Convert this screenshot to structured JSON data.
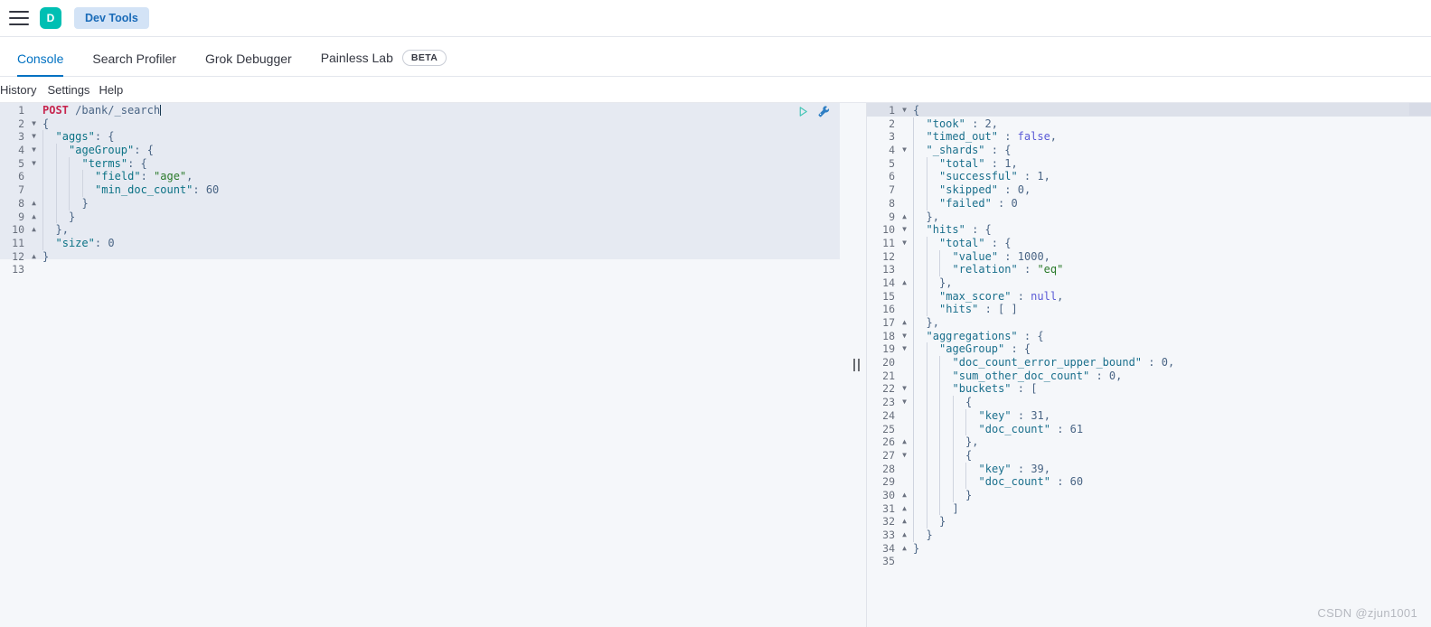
{
  "header": {
    "menu_icon": "hamburger-menu-icon",
    "logo_letter": "D",
    "app_badge": "Dev Tools"
  },
  "tabs": [
    {
      "label": "Console",
      "active": true,
      "badge": null
    },
    {
      "label": "Search Profiler",
      "active": false,
      "badge": null
    },
    {
      "label": "Grok Debugger",
      "active": false,
      "badge": null
    },
    {
      "label": "Painless Lab",
      "active": false,
      "badge": "BETA"
    }
  ],
  "submenu": [
    {
      "label": "History"
    },
    {
      "label": "Settings"
    },
    {
      "label": "Help"
    }
  ],
  "editor_actions": [
    {
      "name": "play-icon",
      "title": "Click to send request"
    },
    {
      "name": "wrench-icon",
      "title": "Open documentation"
    }
  ],
  "request": {
    "method": "POST",
    "url": "/bank/_search",
    "lines": [
      {
        "n": 1,
        "fold": "",
        "indent": 0,
        "parts": [
          {
            "c": "t-method",
            "t": "POST"
          },
          {
            "c": "t-punc",
            "t": " "
          },
          {
            "c": "t-url",
            "t": "/bank/_search"
          },
          {
            "c": "caret",
            "t": ""
          }
        ]
      },
      {
        "n": 2,
        "fold": "v",
        "indent": 0,
        "parts": [
          {
            "c": "t-punc",
            "t": "{"
          }
        ]
      },
      {
        "n": 3,
        "fold": "v",
        "indent": 1,
        "parts": [
          {
            "c": "t-key",
            "t": "\"aggs\""
          },
          {
            "c": "t-punc",
            "t": ": {"
          }
        ]
      },
      {
        "n": 4,
        "fold": "v",
        "indent": 2,
        "parts": [
          {
            "c": "t-key",
            "t": "\"ageGroup\""
          },
          {
            "c": "t-punc",
            "t": ": {"
          }
        ]
      },
      {
        "n": 5,
        "fold": "v",
        "indent": 3,
        "parts": [
          {
            "c": "t-key",
            "t": "\"terms\""
          },
          {
            "c": "t-punc",
            "t": ": {"
          }
        ]
      },
      {
        "n": 6,
        "fold": "",
        "indent": 4,
        "parts": [
          {
            "c": "t-key",
            "t": "\"field\""
          },
          {
            "c": "t-punc",
            "t": ": "
          },
          {
            "c": "t-str",
            "t": "\"age\""
          },
          {
            "c": "t-punc",
            "t": ","
          }
        ]
      },
      {
        "n": 7,
        "fold": "",
        "indent": 4,
        "parts": [
          {
            "c": "t-key",
            "t": "\"min_doc_count\""
          },
          {
            "c": "t-punc",
            "t": ": "
          },
          {
            "c": "t-num",
            "t": "60"
          }
        ]
      },
      {
        "n": 8,
        "fold": "^",
        "indent": 3,
        "parts": [
          {
            "c": "t-punc",
            "t": "}"
          }
        ]
      },
      {
        "n": 9,
        "fold": "^",
        "indent": 2,
        "parts": [
          {
            "c": "t-punc",
            "t": "}"
          }
        ]
      },
      {
        "n": 10,
        "fold": "^",
        "indent": 1,
        "parts": [
          {
            "c": "t-punc",
            "t": "},"
          }
        ]
      },
      {
        "n": 11,
        "fold": "",
        "indent": 1,
        "parts": [
          {
            "c": "t-key",
            "t": "\"size\""
          },
          {
            "c": "t-punc",
            "t": ": "
          },
          {
            "c": "t-num",
            "t": "0"
          }
        ]
      },
      {
        "n": 12,
        "fold": "^",
        "indent": 0,
        "parts": [
          {
            "c": "t-punc",
            "t": "}"
          }
        ]
      },
      {
        "n": 13,
        "fold": "",
        "indent": 0,
        "parts": []
      }
    ]
  },
  "response": {
    "lines": [
      {
        "n": 1,
        "fold": "v",
        "indent": 0,
        "parts": [
          {
            "c": "t-punc",
            "t": "{"
          }
        ]
      },
      {
        "n": 2,
        "fold": "",
        "indent": 1,
        "parts": [
          {
            "c": "t-keyres",
            "t": "\"took\""
          },
          {
            "c": "t-punc",
            "t": " : "
          },
          {
            "c": "t-num",
            "t": "2"
          },
          {
            "c": "t-punc",
            "t": ","
          }
        ]
      },
      {
        "n": 3,
        "fold": "",
        "indent": 1,
        "parts": [
          {
            "c": "t-keyres",
            "t": "\"timed_out\""
          },
          {
            "c": "t-punc",
            "t": " : "
          },
          {
            "c": "t-bool",
            "t": "false"
          },
          {
            "c": "t-punc",
            "t": ","
          }
        ]
      },
      {
        "n": 4,
        "fold": "v",
        "indent": 1,
        "parts": [
          {
            "c": "t-keyres",
            "t": "\"_shards\""
          },
          {
            "c": "t-punc",
            "t": " : {"
          }
        ]
      },
      {
        "n": 5,
        "fold": "",
        "indent": 2,
        "parts": [
          {
            "c": "t-keyres",
            "t": "\"total\""
          },
          {
            "c": "t-punc",
            "t": " : "
          },
          {
            "c": "t-num",
            "t": "1"
          },
          {
            "c": "t-punc",
            "t": ","
          }
        ]
      },
      {
        "n": 6,
        "fold": "",
        "indent": 2,
        "parts": [
          {
            "c": "t-keyres",
            "t": "\"successful\""
          },
          {
            "c": "t-punc",
            "t": " : "
          },
          {
            "c": "t-num",
            "t": "1"
          },
          {
            "c": "t-punc",
            "t": ","
          }
        ]
      },
      {
        "n": 7,
        "fold": "",
        "indent": 2,
        "parts": [
          {
            "c": "t-keyres",
            "t": "\"skipped\""
          },
          {
            "c": "t-punc",
            "t": " : "
          },
          {
            "c": "t-num",
            "t": "0"
          },
          {
            "c": "t-punc",
            "t": ","
          }
        ]
      },
      {
        "n": 8,
        "fold": "",
        "indent": 2,
        "parts": [
          {
            "c": "t-keyres",
            "t": "\"failed\""
          },
          {
            "c": "t-punc",
            "t": " : "
          },
          {
            "c": "t-num",
            "t": "0"
          }
        ]
      },
      {
        "n": 9,
        "fold": "^",
        "indent": 1,
        "parts": [
          {
            "c": "t-punc",
            "t": "},"
          }
        ]
      },
      {
        "n": 10,
        "fold": "v",
        "indent": 1,
        "parts": [
          {
            "c": "t-keyres",
            "t": "\"hits\""
          },
          {
            "c": "t-punc",
            "t": " : {"
          }
        ]
      },
      {
        "n": 11,
        "fold": "v",
        "indent": 2,
        "parts": [
          {
            "c": "t-keyres",
            "t": "\"total\""
          },
          {
            "c": "t-punc",
            "t": " : {"
          }
        ]
      },
      {
        "n": 12,
        "fold": "",
        "indent": 3,
        "parts": [
          {
            "c": "t-keyres",
            "t": "\"value\""
          },
          {
            "c": "t-punc",
            "t": " : "
          },
          {
            "c": "t-num",
            "t": "1000"
          },
          {
            "c": "t-punc",
            "t": ","
          }
        ]
      },
      {
        "n": 13,
        "fold": "",
        "indent": 3,
        "parts": [
          {
            "c": "t-keyres",
            "t": "\"relation\""
          },
          {
            "c": "t-punc",
            "t": " : "
          },
          {
            "c": "t-strres",
            "t": "\"eq\""
          }
        ]
      },
      {
        "n": 14,
        "fold": "^",
        "indent": 2,
        "parts": [
          {
            "c": "t-punc",
            "t": "},"
          }
        ]
      },
      {
        "n": 15,
        "fold": "",
        "indent": 2,
        "parts": [
          {
            "c": "t-keyres",
            "t": "\"max_score\""
          },
          {
            "c": "t-punc",
            "t": " : "
          },
          {
            "c": "t-null",
            "t": "null"
          },
          {
            "c": "t-punc",
            "t": ","
          }
        ]
      },
      {
        "n": 16,
        "fold": "",
        "indent": 2,
        "parts": [
          {
            "c": "t-keyres",
            "t": "\"hits\""
          },
          {
            "c": "t-punc",
            "t": " : [ ]"
          }
        ]
      },
      {
        "n": 17,
        "fold": "^",
        "indent": 1,
        "parts": [
          {
            "c": "t-punc",
            "t": "},"
          }
        ]
      },
      {
        "n": 18,
        "fold": "v",
        "indent": 1,
        "parts": [
          {
            "c": "t-keyres",
            "t": "\"aggregations\""
          },
          {
            "c": "t-punc",
            "t": " : {"
          }
        ]
      },
      {
        "n": 19,
        "fold": "v",
        "indent": 2,
        "parts": [
          {
            "c": "t-keyres",
            "t": "\"ageGroup\""
          },
          {
            "c": "t-punc",
            "t": " : {"
          }
        ]
      },
      {
        "n": 20,
        "fold": "",
        "indent": 3,
        "parts": [
          {
            "c": "t-keyres",
            "t": "\"doc_count_error_upper_bound\""
          },
          {
            "c": "t-punc",
            "t": " : "
          },
          {
            "c": "t-num",
            "t": "0"
          },
          {
            "c": "t-punc",
            "t": ","
          }
        ]
      },
      {
        "n": 21,
        "fold": "",
        "indent": 3,
        "parts": [
          {
            "c": "t-keyres",
            "t": "\"sum_other_doc_count\""
          },
          {
            "c": "t-punc",
            "t": " : "
          },
          {
            "c": "t-num",
            "t": "0"
          },
          {
            "c": "t-punc",
            "t": ","
          }
        ]
      },
      {
        "n": 22,
        "fold": "v",
        "indent": 3,
        "parts": [
          {
            "c": "t-keyres",
            "t": "\"buckets\""
          },
          {
            "c": "t-punc",
            "t": " : ["
          }
        ]
      },
      {
        "n": 23,
        "fold": "v",
        "indent": 4,
        "parts": [
          {
            "c": "t-punc",
            "t": "{"
          }
        ]
      },
      {
        "n": 24,
        "fold": "",
        "indent": 5,
        "parts": [
          {
            "c": "t-keyres",
            "t": "\"key\""
          },
          {
            "c": "t-punc",
            "t": " : "
          },
          {
            "c": "t-num",
            "t": "31"
          },
          {
            "c": "t-punc",
            "t": ","
          }
        ]
      },
      {
        "n": 25,
        "fold": "",
        "indent": 5,
        "parts": [
          {
            "c": "t-keyres",
            "t": "\"doc_count\""
          },
          {
            "c": "t-punc",
            "t": " : "
          },
          {
            "c": "t-num",
            "t": "61"
          }
        ]
      },
      {
        "n": 26,
        "fold": "^",
        "indent": 4,
        "parts": [
          {
            "c": "t-punc",
            "t": "},"
          }
        ]
      },
      {
        "n": 27,
        "fold": "v",
        "indent": 4,
        "parts": [
          {
            "c": "t-punc",
            "t": "{"
          }
        ]
      },
      {
        "n": 28,
        "fold": "",
        "indent": 5,
        "parts": [
          {
            "c": "t-keyres",
            "t": "\"key\""
          },
          {
            "c": "t-punc",
            "t": " : "
          },
          {
            "c": "t-num",
            "t": "39"
          },
          {
            "c": "t-punc",
            "t": ","
          }
        ]
      },
      {
        "n": 29,
        "fold": "",
        "indent": 5,
        "parts": [
          {
            "c": "t-keyres",
            "t": "\"doc_count\""
          },
          {
            "c": "t-punc",
            "t": " : "
          },
          {
            "c": "t-num",
            "t": "60"
          }
        ]
      },
      {
        "n": 30,
        "fold": "^",
        "indent": 4,
        "parts": [
          {
            "c": "t-punc",
            "t": "}"
          }
        ]
      },
      {
        "n": 31,
        "fold": "^",
        "indent": 3,
        "parts": [
          {
            "c": "t-punc",
            "t": "]"
          }
        ]
      },
      {
        "n": 32,
        "fold": "^",
        "indent": 2,
        "parts": [
          {
            "c": "t-punc",
            "t": "}"
          }
        ]
      },
      {
        "n": 33,
        "fold": "^",
        "indent": 1,
        "parts": [
          {
            "c": "t-punc",
            "t": "}"
          }
        ]
      },
      {
        "n": 34,
        "fold": "^",
        "indent": 0,
        "parts": [
          {
            "c": "t-punc",
            "t": "}"
          }
        ]
      },
      {
        "n": 35,
        "fold": "",
        "indent": 0,
        "parts": []
      }
    ]
  },
  "watermark": "CSDN @zjun1001",
  "colors": {
    "accent": "#0071c2",
    "logo": "#00bfb3",
    "badge_bg": "#d3e3f6",
    "editor_bg": "#f5f7fa",
    "request_block_bg": "#e6eaf2"
  }
}
